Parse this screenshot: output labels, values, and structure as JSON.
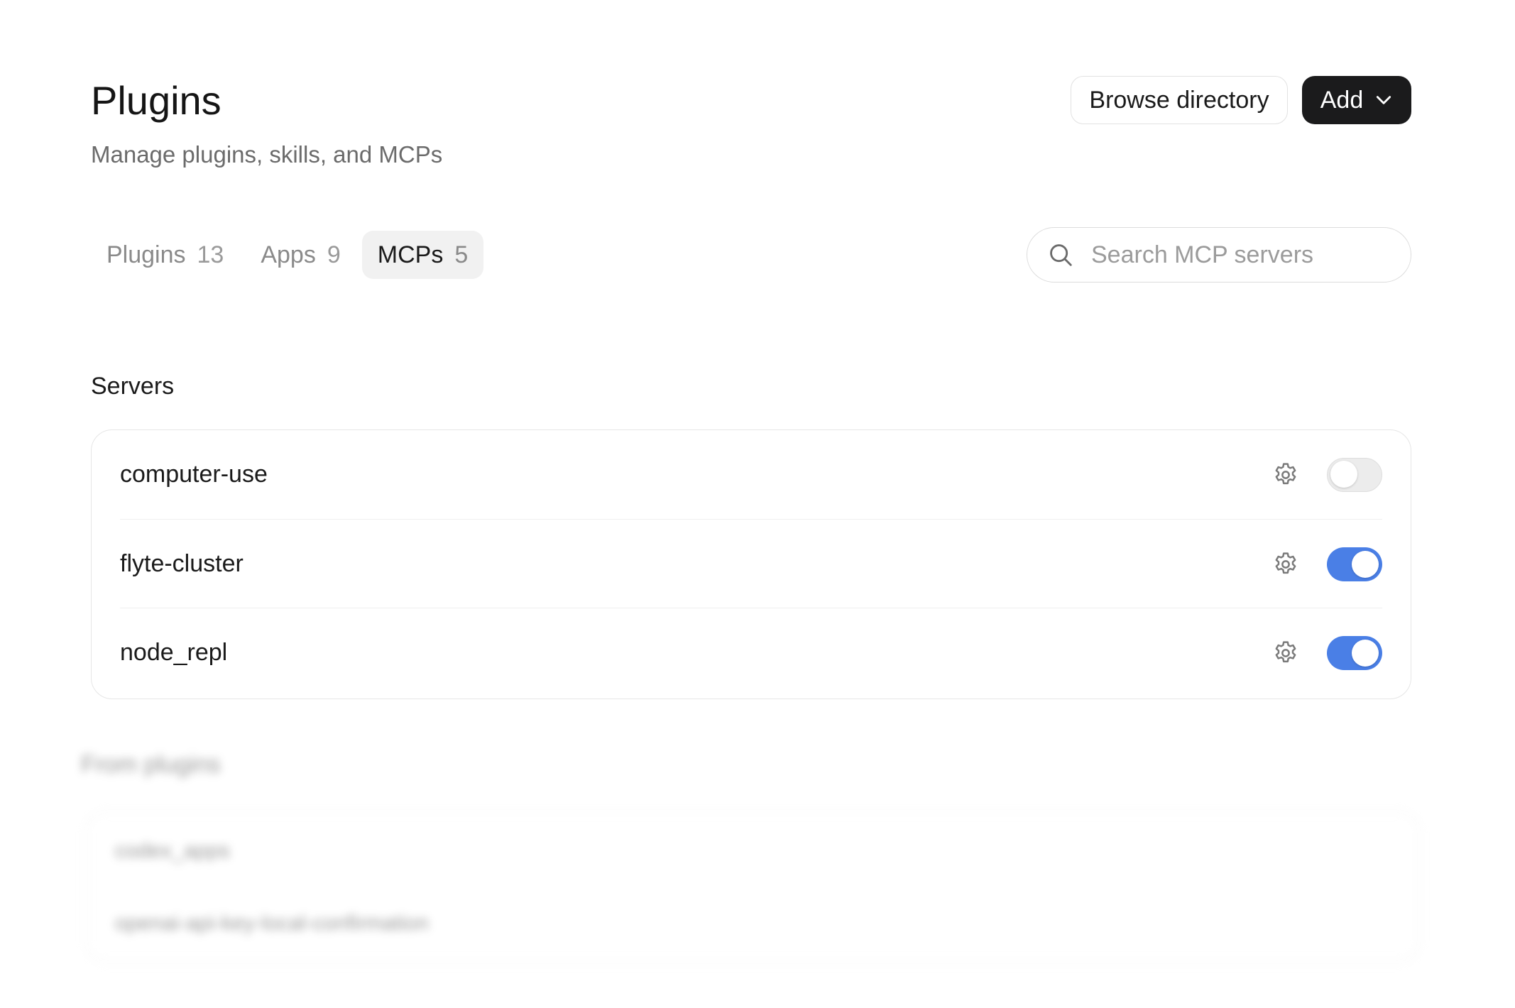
{
  "header": {
    "title": "Plugins",
    "subtitle": "Manage plugins, skills, and MCPs",
    "browse_label": "Browse directory",
    "add_label": "Add",
    "add_icon": "chevron-down-icon"
  },
  "tabs": [
    {
      "label": "Plugins",
      "count": "13",
      "active": false
    },
    {
      "label": "Apps",
      "count": "9",
      "active": false
    },
    {
      "label": "MCPs",
      "count": "5",
      "active": true
    }
  ],
  "search": {
    "placeholder": "Search MCP servers",
    "value": "",
    "icon": "search-icon"
  },
  "servers": {
    "title": "Servers",
    "items": [
      {
        "name": "computer-use",
        "enabled": false
      },
      {
        "name": "flyte-cluster",
        "enabled": true
      },
      {
        "name": "node_repl",
        "enabled": true
      }
    ]
  },
  "from_plugins": {
    "title": "From plugins",
    "items": [
      {
        "name": "codex_apps"
      },
      {
        "name": "openai-api-key-local-confirmation"
      }
    ]
  },
  "colors": {
    "accent": "#4a7fe6",
    "primary_button": "#1b1b1c",
    "muted_text": "#6b6b6b"
  }
}
